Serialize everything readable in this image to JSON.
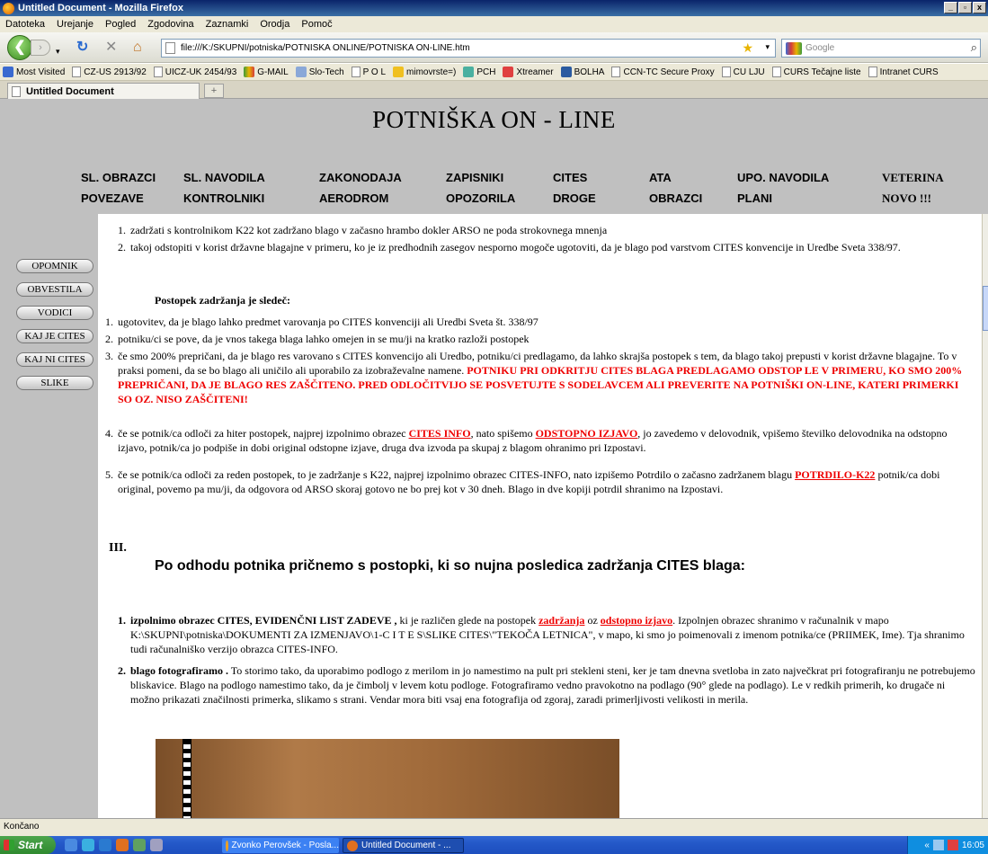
{
  "window": {
    "title": "Untitled Document - Mozilla Firefox"
  },
  "menu": [
    "Datoteka",
    "Urejanje",
    "Pogled",
    "Zgodovina",
    "Zaznamki",
    "Orodja",
    "Pomoč"
  ],
  "nav": {
    "url": "file:///K:/SKUPNI/potniska/POTNISKA ONLINE/POTNISKA ON-LINE.htm",
    "search_placeholder": "Google"
  },
  "bookmarks": [
    "Most Visited",
    "CZ-US 2913/92",
    "UICZ-UK 2454/93",
    "G-MAIL",
    "Slo-Tech",
    "P O L",
    "mimovrste=)",
    "PCH",
    "Xtreamer",
    "BOLHA",
    "CCN-TC Secure Proxy",
    "CU LJU",
    "CURS Tečajne liste",
    "Intranet CURS"
  ],
  "tab": {
    "label": "Untitled Document"
  },
  "site": {
    "title": "POTNIŠKA  ON - LINE",
    "nav_row1": [
      "SL. OBRAZCI",
      "SL. NAVODILA",
      "ZAKONODAJA",
      "ZAPISNIKI",
      "CITES",
      "ATA",
      "UPO. NAVODILA",
      "VETERINA"
    ],
    "nav_row2": [
      "POVEZAVE",
      "KONTROLNIKI",
      "AERODROM",
      "OPOZORILA",
      "DROGE",
      "OBRAZCI",
      "PLANI",
      "NOVO !!!"
    ]
  },
  "sidebar": [
    "OPOMNIK",
    "OBVESTILA",
    "VODICI",
    "KAJ JE CITES",
    "KAJ NI CITES",
    "SLIKE"
  ],
  "content": {
    "list1": [
      {
        "n": "1.",
        "text": "zadržati s kontrolnikom K22 kot zadržano blago v začasno hrambo dokler ARSO ne poda strokovnega mnenja"
      },
      {
        "n": "2.",
        "text": "takoj odstopiti v korist državne blagajne v primeru, ko je iz predhodnih zasegov nesporno mogoče ugotoviti, da je blago pod varstvom CITES konvencije in Uredbe Sveta 338/97."
      }
    ],
    "subheading": "Postopek zadržanja je sledeč:",
    "list2": {
      "i1": {
        "n": "1.",
        "text": "ugotovitev, da je blago lahko predmet varovanja po CITES konvenciji ali Uredbi Sveta št. 338/97"
      },
      "i2": {
        "n": "2.",
        "text": "potniku/ci se pove, da je vnos takega blaga lahko omejen in se mu/ji na kratko razloži postopek"
      },
      "i3": {
        "n": "3.",
        "text": "če smo 200% prepričani, da je blago res varovano s CITES konvencijo ali Uredbo, potniku/ci predlagamo, da lahko skrajša postopek s tem, da blago takoj prepusti v korist državne blagajne. To v praksi pomeni, da se bo blago ali uničilo ali uporabilo za izobraževalne namene.",
        "red": "POTNIKU PRI ODKRITJU CITES BLAGA PREDLAGAMO ODSTOP LE V PRIMERU, KO SMO 200% PREPRIČANI, DA JE BLAGO RES ZAŠČITENO. PRED ODLOČITVIJO SE POSVETUJTE S SODELAVCEM ALI PREVERITE NA POTNIŠKI ON-LINE, KATERI PRIMERKI SO OZ. NISO ZAŠČITENI!"
      },
      "i4": {
        "n": "4.",
        "a": "če se potnik/ca odloči za hiter postopek, najprej izpolnimo obrazec",
        "link1": "CITES   INFO",
        "b": ", nato spišemo",
        "link2": "ODSTOPNO IZJAVO",
        "c": ", jo zavedemo v delovodnik, vpišemo številko delovodnika na odstopno izjavo, potnik/ca jo podpiše in dobi original odstopne izjave, druga dva izvoda pa skupaj z blagom ohranimo pri Izpostavi."
      },
      "i5": {
        "n": "5.",
        "a": "če se potnik/ca odloči za reden postopek, to je zadržanje s K22, najprej izpolnimo obrazec CITES-INFO, nato izpišemo Potrdilo o začasno zadržanem blagu",
        "link": "POTRDILO-K22",
        "b": "potnik/ca dobi original, povemo pa mu/ji, da odgovora od ARSO skoraj gotovo ne bo prej kot v 30 dneh. Blago in dve kopiji potrdil shranimo na Izpostavi."
      }
    },
    "section_num": "III.",
    "section_heading": "Po odhodu potnika pričnemo s postopki, ki so nujna posledica zadržanja CITES blaga:",
    "list3": {
      "i1": {
        "n": "1.",
        "bold": "izpolnimo obrazec CITES, EVIDENČNI LIST ZADEVE ,",
        "a": "ki je različen glede na postopek",
        "link1": "zadržanja",
        "b": "oz",
        "link2": "odstopno izjavo",
        "c": ". Izpolnjen obrazec shranimo v računalnik v mapo K:\\SKUPNI\\potniska\\DOKUMENTI ZA IZMENJAVO\\1-C I T E S\\SLIKE CITES\\\"TEKOČA LETNICA\", v mapo, ki smo jo poimenovali z imenom potnika/ce (PRIIMEK, Ime). Tja shranimo tudi računalniško verzijo obrazca CITES-INFO."
      },
      "i2": {
        "n": "2.",
        "bold": "blago fotografiramo .",
        "a": "To storimo tako, da uporabimo podlogo z merilom in jo namestimo na pult pri stekleni steni, ker je tam dnevna svetloba in zato največkrat pri fotografiranju ne potrebujemo bliskavice. Blago na podlogo namestimo tako, da je čimbolj v levem kotu podloge. Fotografiramo vedno pravokotno na podlago (90° glede na podlago). Le v redkih primerih, ko drugače ni možno prikazati značilnosti primerka, slikamo s strani. Vendar mora biti vsaj ena fotografija od zgoraj, zaradi primerljivosti velikosti in merila."
      }
    }
  },
  "status": "Končano",
  "taskbar": {
    "start": "Start",
    "btn1": "Zvonko Perovšek - Posla...",
    "btn2": "Untitled Document - ...",
    "clock": "16:05"
  }
}
